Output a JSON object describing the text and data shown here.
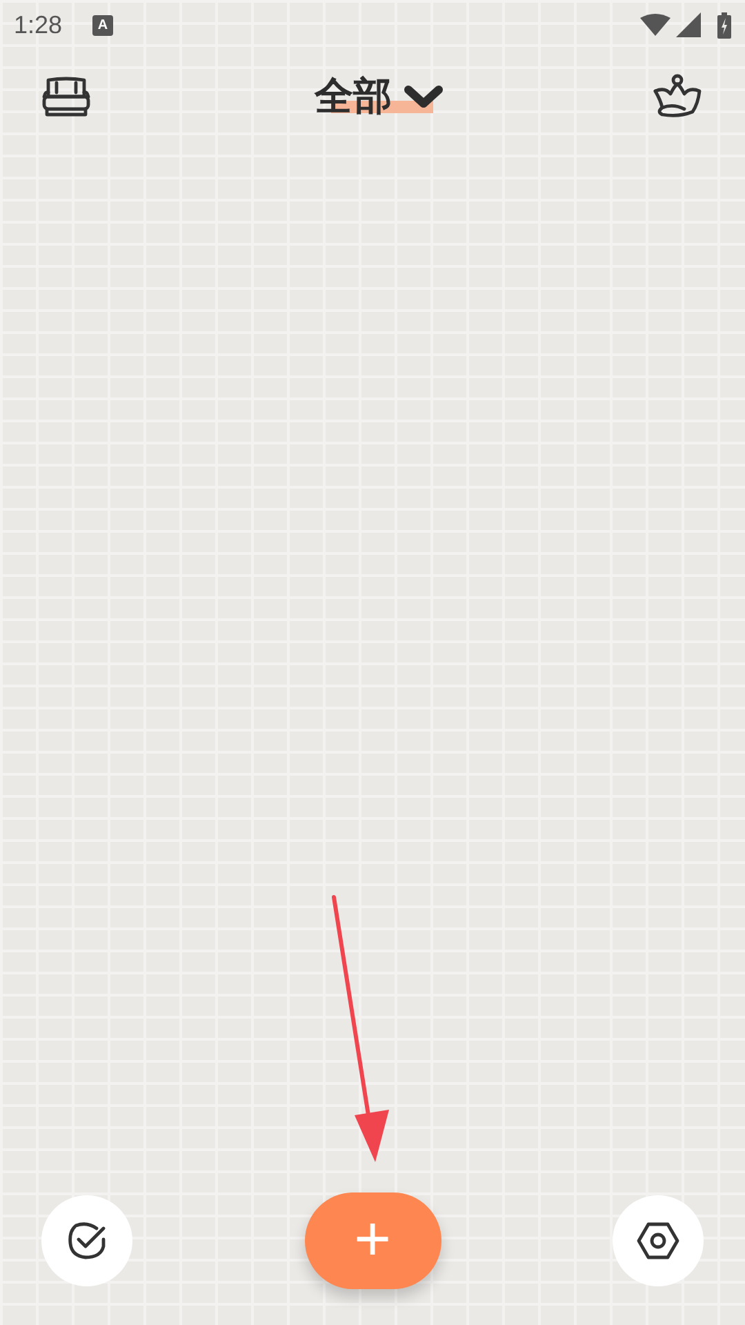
{
  "status_bar": {
    "time": "1:28",
    "notification_icon": "A"
  },
  "header": {
    "title": "全部"
  },
  "add_button": {
    "label": "+"
  }
}
